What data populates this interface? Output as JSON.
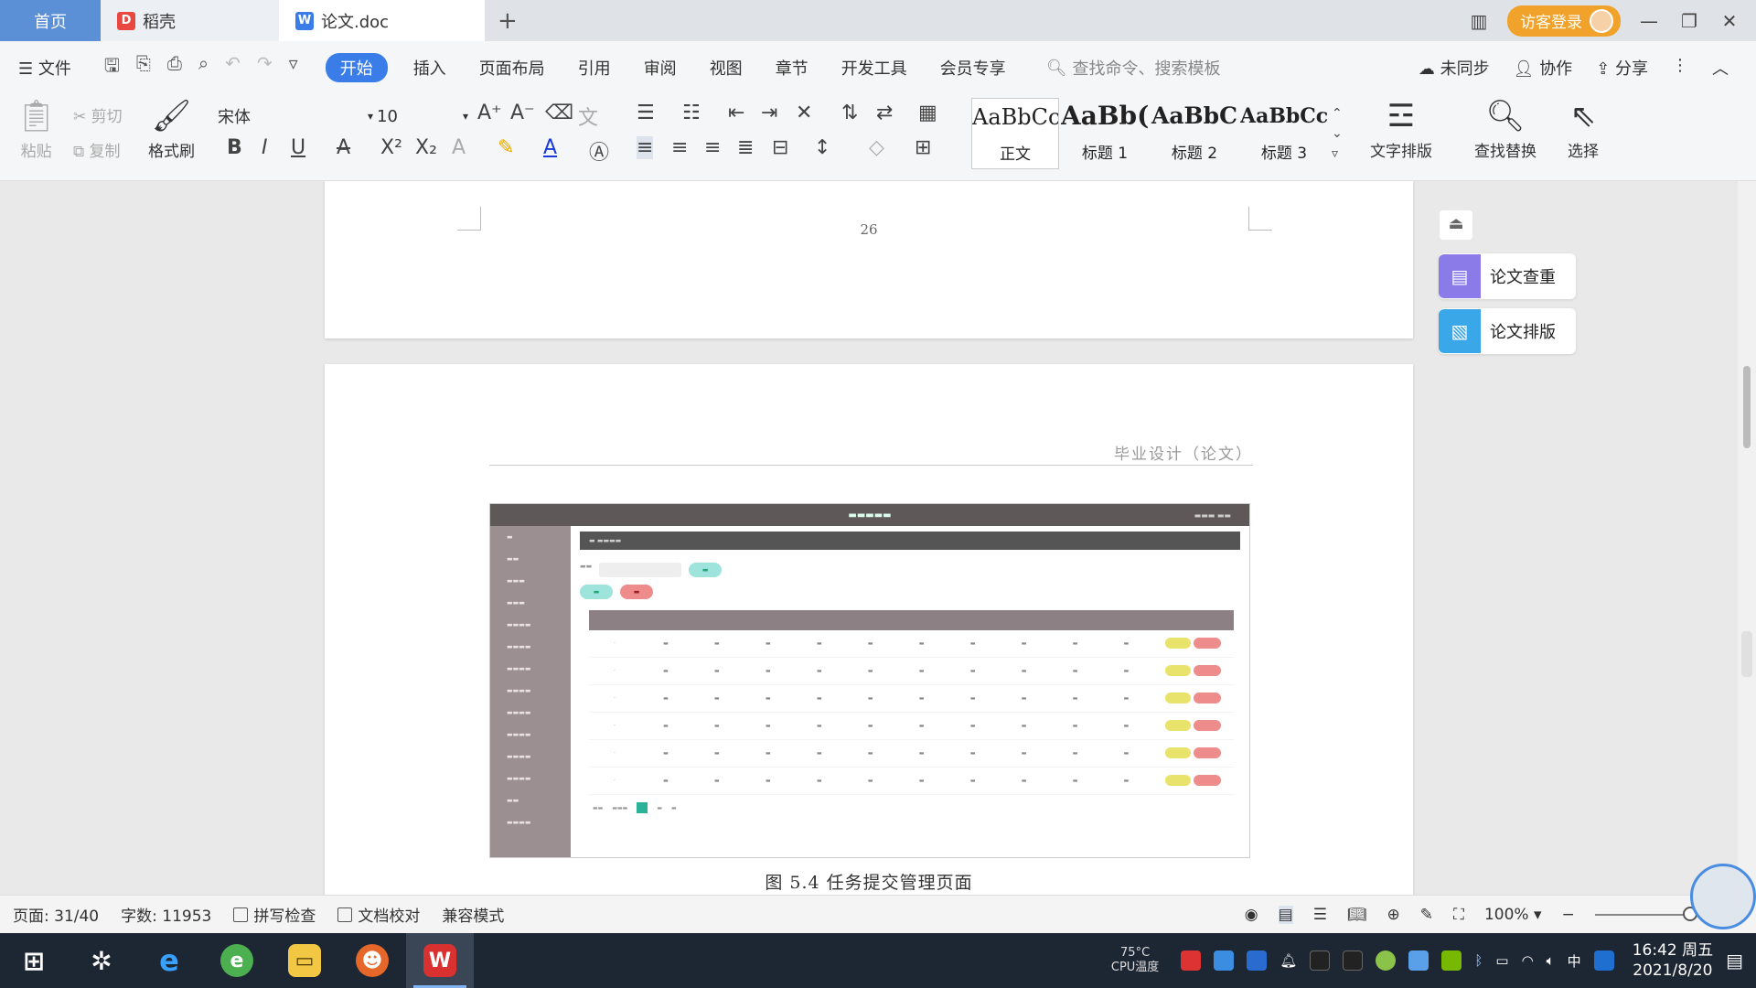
{
  "tabs": {
    "home": "首页",
    "daoke": "稻壳",
    "doc": "论文.doc",
    "new_tab": "+"
  },
  "titlebar": {
    "login": "访客登录"
  },
  "menu": {
    "file": "文件",
    "items": [
      "开始",
      "插入",
      "页面布局",
      "引用",
      "审阅",
      "视图",
      "章节",
      "开发工具",
      "会员专享"
    ],
    "search_placeholder": "查找命令、搜索模板",
    "right": [
      "未同步",
      "协作",
      "分享"
    ]
  },
  "ribbon": {
    "paste": "粘贴",
    "cut": "剪切",
    "copy": "复制",
    "format_painter": "格式刷",
    "font_name": "宋体",
    "font_size": "10",
    "styles": [
      {
        "sample": "AaBbCcI",
        "label": "正文"
      },
      {
        "sample": "AaBb(",
        "label": "标题 1"
      },
      {
        "sample": "AaBbC",
        "label": "标题 2"
      },
      {
        "sample": "AaBbCcI",
        "label": "标题 3"
      }
    ],
    "text_layout": "文字排版",
    "find_replace": "查找替换",
    "select": "选择"
  },
  "document": {
    "page_number": "26",
    "header_text": "毕业设计（论文）",
    "figure_caption": "图 5.4  任务提交管理页面",
    "screenshot": {
      "rows": 6,
      "accent_colors": {
        "bar": "#5e5858",
        "sidebar": "#9c8f92",
        "edit": "#e8e36a",
        "delete": "#ee8c8c",
        "search": "#9fe3dd"
      }
    }
  },
  "side_panel": {
    "check": "论文查重",
    "layout": "论文排版"
  },
  "statusbar": {
    "page": "页面: 31/40",
    "words": "字数: 11953",
    "spell_check": "拼写检查",
    "doc_proof": "文档校对",
    "compat_mode": "兼容模式",
    "zoom": "100%"
  },
  "taskbar": {
    "cpu_temp": "75°C",
    "cpu_label": "CPU温度",
    "ime": "中",
    "time": "16:42 周五",
    "date": "2021/8/20"
  }
}
